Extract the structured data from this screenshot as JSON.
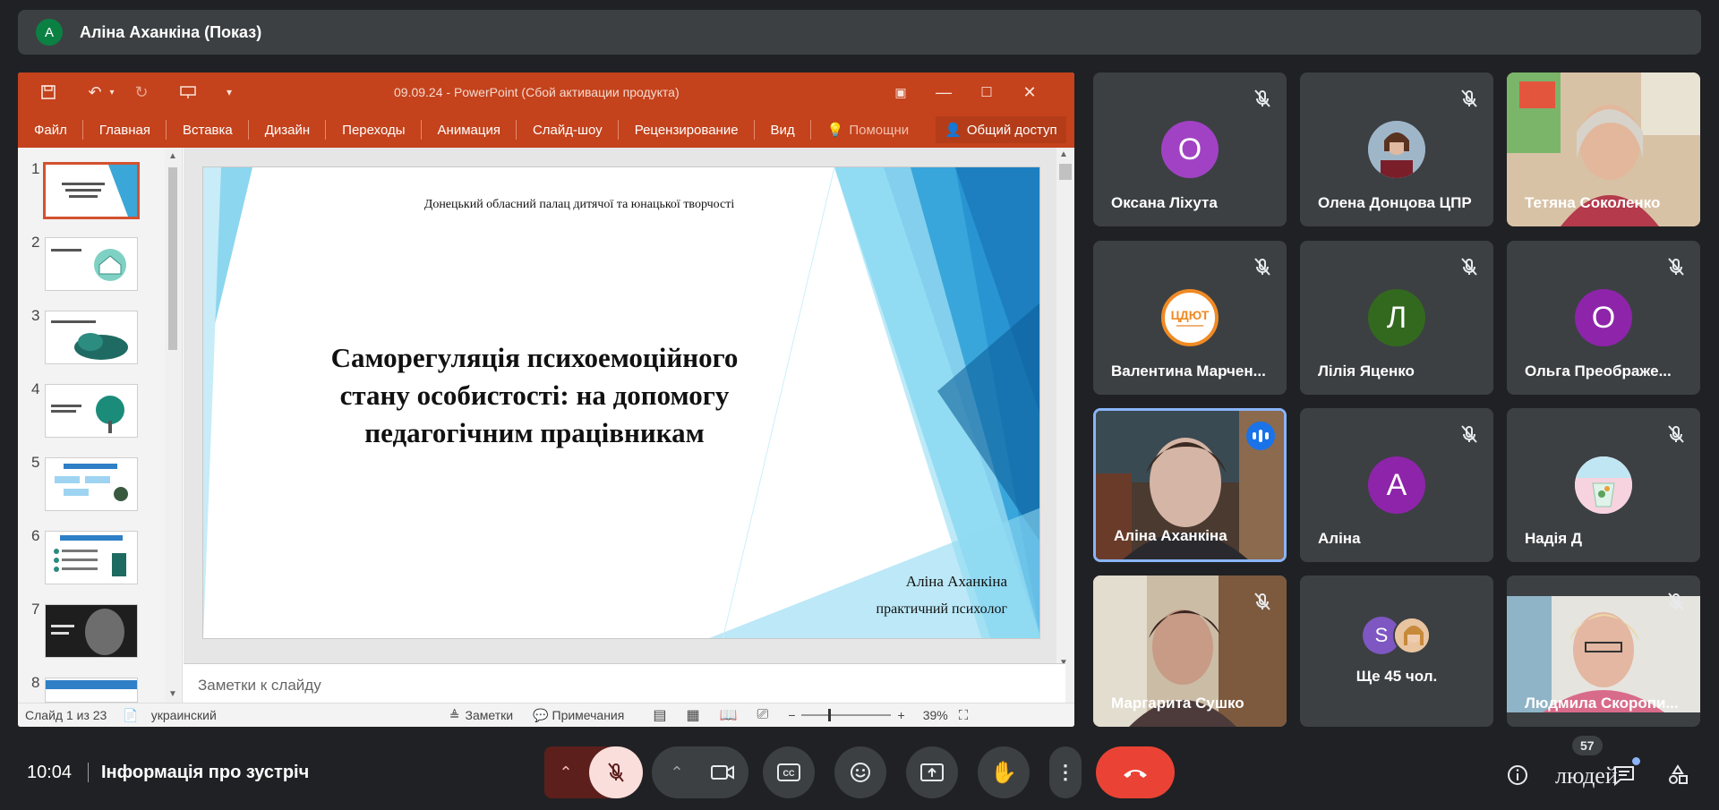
{
  "presenter": {
    "avatar_letter": "A",
    "label": "Аліна Аханкіна (Показ)"
  },
  "ppt": {
    "window_title": "09.09.24 - PowerPoint (Сбой активации продукта)",
    "tabs": [
      "Файл",
      "Главная",
      "Вставка",
      "Дизайн",
      "Переходы",
      "Анимация",
      "Слайд-шоу",
      "Рецензирование",
      "Вид"
    ],
    "help_label": "Помощни",
    "share_label": "Общий доступ",
    "slide_numbers": [
      "1",
      "2",
      "3",
      "4",
      "5",
      "6",
      "7",
      "8"
    ],
    "slide": {
      "org": "Донецький обласний палац дитячої та юнацької творчості",
      "title": "Саморегуляція психоемоційного стану особистості: на допомогу педагогічним працівникам",
      "author": "Аліна Аханкіна",
      "role": "практичний психолог"
    },
    "notes_placeholder": "Заметки к слайду",
    "status": {
      "slide_count": "Слайд 1 из 23",
      "language": "украинский",
      "notes_btn": "Заметки",
      "comments_btn": "Примечания",
      "zoom": "39%"
    }
  },
  "participants": [
    {
      "name": "Оксана Ліхута",
      "letter": "О",
      "color": "#a142c4"
    },
    {
      "name": "Олена Донцова ЦПР"
    },
    {
      "name": "Тетяна Соколенко"
    },
    {
      "name": "Валентина Марчен..."
    },
    {
      "name": "Лілія Яценко",
      "letter": "Л",
      "color": "#33691e"
    },
    {
      "name": "Ольга Преображе...",
      "letter": "О",
      "color": "#8e24aa"
    },
    {
      "name": "Аліна Аханкіна"
    },
    {
      "name": "Аліна",
      "letter": "А",
      "color": "#8e24aa"
    },
    {
      "name": "Надія Д"
    },
    {
      "name": "Маргарита Сушко"
    },
    {
      "name": "Ще 45 чол.",
      "letter": "S",
      "color": "#7e57c2"
    },
    {
      "name": "Людмила Скоропи..."
    }
  ],
  "bottom": {
    "time": "10:04",
    "meeting_info": "Інформація про зустріч",
    "people_count": "57",
    "people_label": "людей"
  },
  "colors": {
    "end_call": "#ea4335",
    "mic_off_bg": "#f9dedc",
    "ppt_accent": "#c4421c"
  }
}
